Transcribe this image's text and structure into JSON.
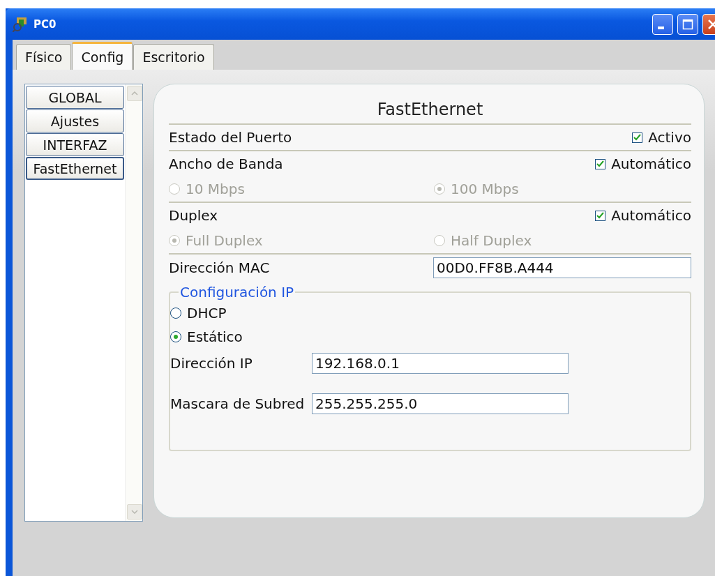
{
  "window": {
    "title": "PC0"
  },
  "tabs": [
    {
      "label": "Físico",
      "selected": false
    },
    {
      "label": "Config",
      "selected": true
    },
    {
      "label": "Escritorio",
      "selected": false
    }
  ],
  "sidebar": {
    "items": [
      {
        "label": "GLOBAL",
        "selected": false
      },
      {
        "label": "Ajustes",
        "selected": false
      },
      {
        "label": "INTERFAZ",
        "selected": false
      },
      {
        "label": "FastEthernet",
        "selected": true
      }
    ]
  },
  "panel": {
    "title": "FastEthernet",
    "port_status": {
      "label": "Estado del Puerto",
      "checkbox": {
        "label": "Activo",
        "checked": true
      }
    },
    "bandwidth": {
      "label": "Ancho de Banda",
      "checkbox": {
        "label": "Automático",
        "checked": true
      },
      "options": [
        {
          "label": "10 Mbps",
          "selected": false,
          "disabled": true
        },
        {
          "label": "100 Mbps",
          "selected": true,
          "disabled": true
        }
      ]
    },
    "duplex": {
      "label": "Duplex",
      "checkbox": {
        "label": "Automático",
        "checked": true
      },
      "options": [
        {
          "label": "Full Duplex",
          "selected": true,
          "disabled": true
        },
        {
          "label": "Half Duplex",
          "selected": false,
          "disabled": true
        }
      ]
    },
    "mac": {
      "label": "Dirección MAC",
      "value": "00D0.FF8B.A444"
    },
    "ip_config": {
      "title": "Configuración IP",
      "modes": [
        {
          "label": "DHCP",
          "selected": false
        },
        {
          "label": "Estático",
          "selected": true
        }
      ],
      "fields": [
        {
          "label": "Dirección IP",
          "value": "192.168.0.1"
        },
        {
          "label": "Mascara de Subred",
          "value": "255.255.255.0"
        }
      ]
    }
  }
}
